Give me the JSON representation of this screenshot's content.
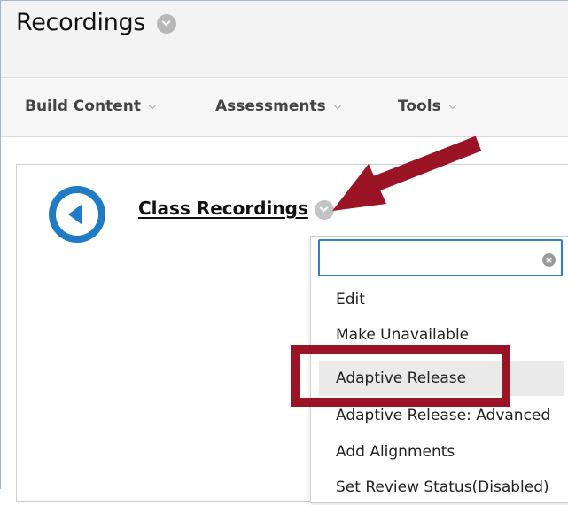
{
  "header": {
    "title": "Recordings"
  },
  "toolbar": {
    "items": [
      {
        "label": "Build Content"
      },
      {
        "label": "Assessments"
      },
      {
        "label": "Tools"
      }
    ]
  },
  "content": {
    "item_title": "Class Recordings"
  },
  "menu": {
    "search_value": "",
    "items": [
      {
        "label": "Edit"
      },
      {
        "label": "Make Unavailable"
      },
      {
        "label": "Adaptive Release"
      },
      {
        "label": "Adaptive Release: Advanced"
      },
      {
        "label": "Add Alignments"
      },
      {
        "label": "Set Review Status(Disabled)"
      }
    ],
    "selected_index": 2
  },
  "annotation": {
    "arrow_color": "#9a1426",
    "highlight_color": "#9a1426",
    "accent_blue": "#1f7bc4"
  }
}
